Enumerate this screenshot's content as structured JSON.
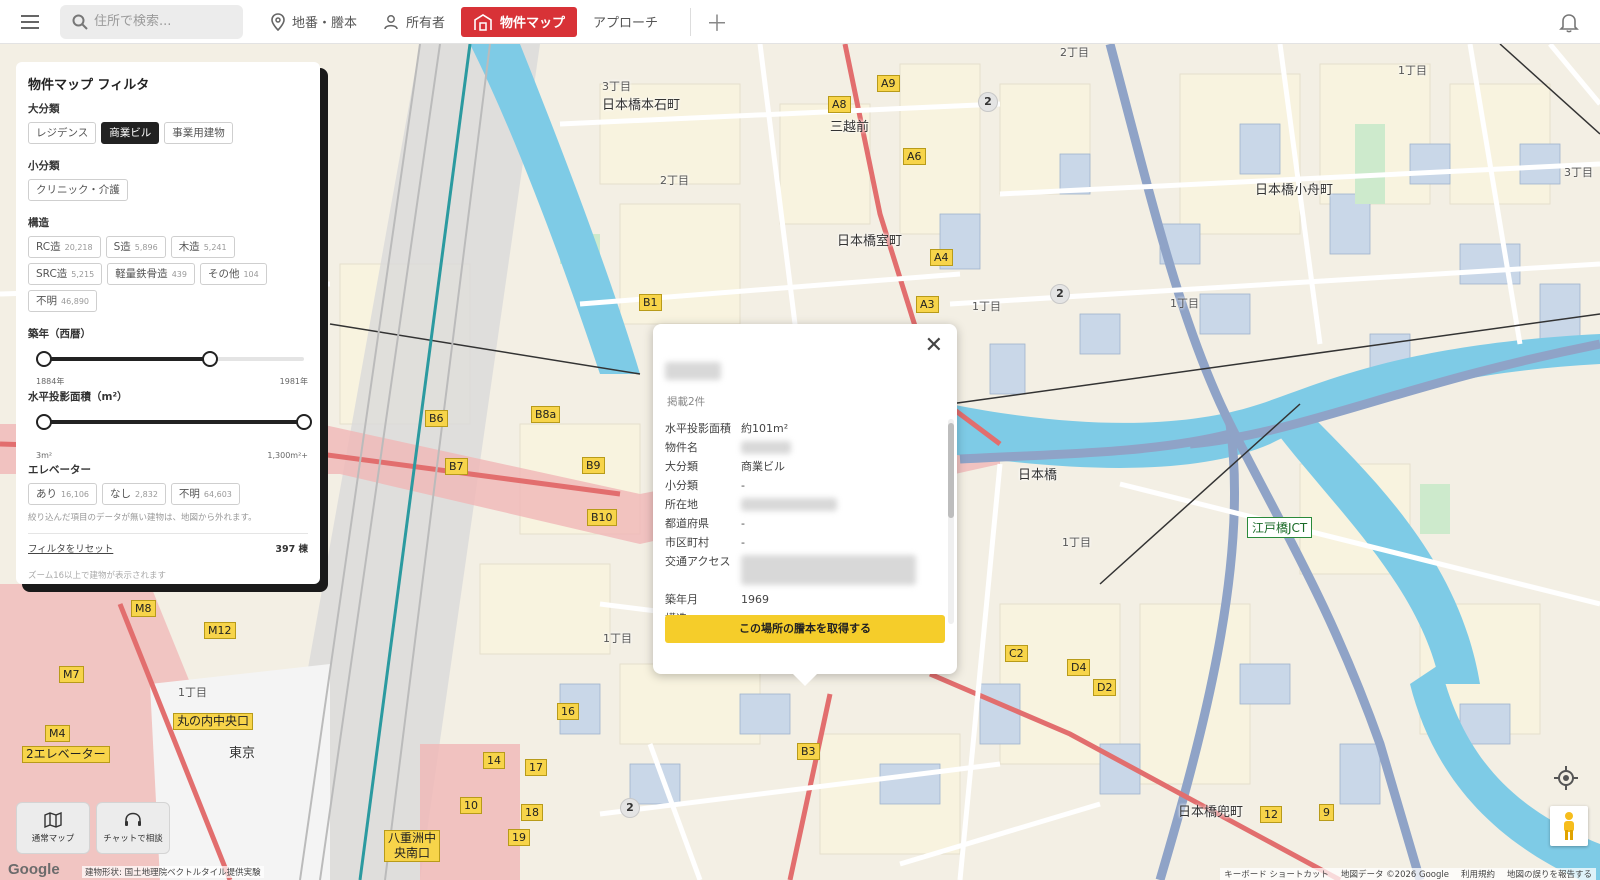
{
  "topbar": {
    "search_placeholder": "住所で検索...",
    "nav": [
      {
        "label": "地番・謄本",
        "icon": "location-pin-icon"
      },
      {
        "label": "所有者",
        "icon": "person-icon"
      },
      {
        "label": "物件マップ",
        "icon": "building-icon",
        "active": true
      },
      {
        "label": "アプローチ"
      }
    ],
    "add_label": "＋"
  },
  "filter": {
    "title": "物件マップ フィルタ",
    "major": {
      "label": "大分類",
      "options": [
        {
          "label": "レジデンス"
        },
        {
          "label": "商業ビル",
          "selected": true
        },
        {
          "label": "事業用建物"
        }
      ]
    },
    "minor": {
      "label": "小分類",
      "options": [
        {
          "label": "クリニック・介護"
        }
      ]
    },
    "structure": {
      "label": "構造",
      "options": [
        {
          "label": "RC造",
          "count": "20,218"
        },
        {
          "label": "S造",
          "count": "5,896"
        },
        {
          "label": "木造",
          "count": "5,241"
        },
        {
          "label": "SRC造",
          "count": "5,215"
        },
        {
          "label": "軽量鉄骨造",
          "count": "439"
        },
        {
          "label": "その他",
          "count": "104"
        },
        {
          "label": "不明",
          "count": "46,890"
        }
      ]
    },
    "year": {
      "label": "築年（西暦）",
      "min": "1884年",
      "max": "1981年",
      "low": 0.0,
      "high": 0.64
    },
    "area": {
      "label": "水平投影面積（m²）",
      "min": "3m²",
      "max": "1,300m²+",
      "low": 0.0,
      "high": 1.0
    },
    "elevator": {
      "label": "エレベーター",
      "options": [
        {
          "label": "あり",
          "count": "16,106"
        },
        {
          "label": "なし",
          "count": "2,832"
        },
        {
          "label": "不明",
          "count": "64,603"
        }
      ]
    },
    "note": "絞り込んだ項目のデータが無い建物は、地図から外れます。",
    "reset_label": "フィルタをリセット",
    "result_count": "397 棟",
    "zoom_note": "ズーム16以上で建物が表示されます"
  },
  "popup": {
    "subtitle": "掲載2件",
    "rows": [
      {
        "key": "水平投影面積",
        "value": "約101m²"
      },
      {
        "key": "物件名",
        "value": ""
      },
      {
        "key": "大分類",
        "value": "商業ビル"
      },
      {
        "key": "小分類",
        "value": "-"
      },
      {
        "key": "所在地",
        "value": ""
      },
      {
        "key": "都道府県",
        "value": "-"
      },
      {
        "key": "市区町村",
        "value": "-"
      },
      {
        "key": "交通アクセス",
        "value": ""
      },
      {
        "key": "築年月",
        "value": "1969"
      },
      {
        "key": "構造",
        "value": "-"
      }
    ],
    "cta_label": "この場所の謄本を取得する",
    "close_label": "✕"
  },
  "map": {
    "labels": [
      {
        "text": "日本橋本石町"
      },
      {
        "text": "三越前"
      },
      {
        "text": "日本橋室町"
      },
      {
        "text": "日本橋小舟町"
      },
      {
        "text": "日本橋"
      },
      {
        "text": "日本橋兜町"
      },
      {
        "text": "東京"
      },
      {
        "text": "丸の内中央口"
      },
      {
        "text": "2エレベーター"
      },
      {
        "text": "八重洲中央南口"
      },
      {
        "text": "江戸橋JCT"
      },
      {
        "text": "2丁目"
      },
      {
        "text": "1丁目"
      },
      {
        "text": "3丁目"
      }
    ],
    "exits": [
      "A9",
      "A8",
      "A6",
      "A4",
      "A3",
      "B1",
      "B6",
      "B8a",
      "B7",
      "B9",
      "B10",
      "B3",
      "C2",
      "D4",
      "D2",
      "M8",
      "M12",
      "M7",
      "M4",
      "16",
      "14",
      "17",
      "10",
      "18",
      "19",
      "12",
      "9"
    ],
    "clusters": [
      "2",
      "2",
      "2"
    ]
  },
  "bottom": {
    "normal_map_label": "通常マップ",
    "chat_label": "チャットで相談",
    "google": "Google",
    "attribution": "建物形状: 国土地理院ベクトルタイル提供実験",
    "footer_links": [
      "キーボード ショートカット",
      "地図データ ©2026 Google",
      "利用規約",
      "地図の誤りを報告する"
    ]
  },
  "colors": {
    "accent": "#d83237",
    "cta": "#f5cd2a",
    "river": "#7ecbe6",
    "rail": "#e06666"
  }
}
